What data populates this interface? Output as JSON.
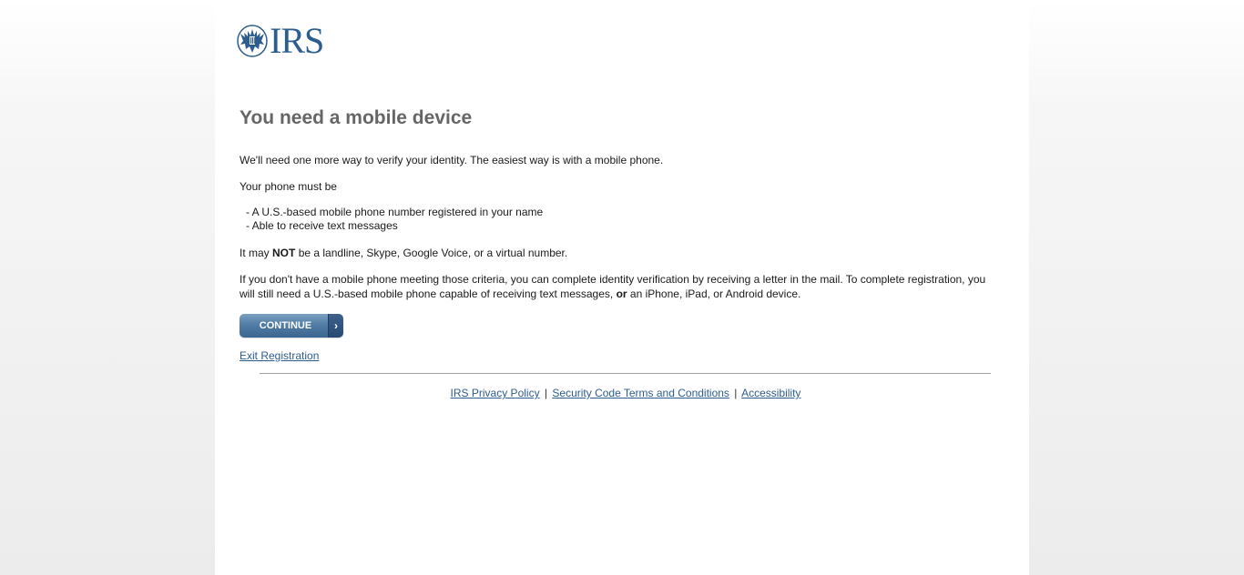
{
  "logo": {
    "text": "IRS",
    "icon": "irs-eagle-icon",
    "color": "#2d5c8e"
  },
  "main": {
    "title": "You need a mobile device",
    "intro": "We'll need one more way to verify your identity. The easiest way is with a mobile phone.",
    "must_heading": "Your phone must be",
    "requirements": [
      "- A U.S.-based mobile phone number registered in your name",
      "- Able to receive text messages"
    ],
    "not_prefix": "It may ",
    "not_bold": "NOT",
    "not_suffix": " be a landline, Skype, Google Voice, or a virtual number.",
    "criteria_part1": "If you don't have a mobile phone meeting those criteria, you can complete identity verification by receiving a letter in the mail. To complete registration, you will still need a U.S.-based mobile phone capable of receiving text messages, ",
    "criteria_bold": "or",
    "criteria_part2": " an iPhone, iPad, or Android device."
  },
  "actions": {
    "continue_label": "CONTINUE",
    "continue_arrow": "›",
    "exit_label": "Exit Registration"
  },
  "footer": {
    "links": [
      "IRS Privacy Policy",
      "Security Code Terms and Conditions",
      "Accessibility"
    ],
    "separator": "|"
  },
  "colors": {
    "brand": "#2d5c8e",
    "title": "#666666",
    "button": "#4f7aa3"
  }
}
